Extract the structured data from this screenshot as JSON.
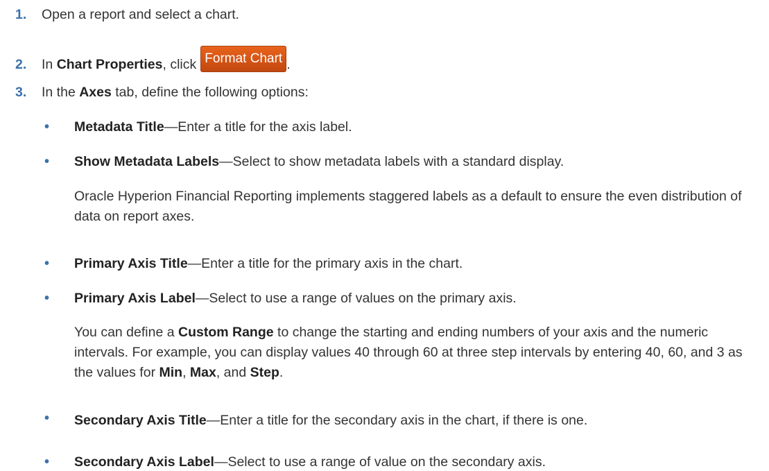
{
  "steps": [
    {
      "num": "1.",
      "text": "Open a report and select a chart."
    },
    {
      "num": "2.",
      "pre": "In ",
      "bold": "Chart Properties",
      "post": ", click",
      "button_label": "Format Chart",
      "after": "."
    },
    {
      "num": "3.",
      "pre": "In the ",
      "bold": "Axes",
      "post": " tab, define the following options:"
    }
  ],
  "options": [
    {
      "bullet": "•",
      "term": "Metadata Title",
      "desc": "—Enter a title for the axis label."
    },
    {
      "bullet": "•",
      "term": "Show Metadata Labels",
      "desc": "—Select to show metadata labels with a standard display."
    },
    {
      "bullet": "•",
      "term": "Primary Axis Title",
      "desc": "—Enter a title for the primary axis in the chart."
    },
    {
      "bullet": "•",
      "term": "Primary Axis Label",
      "desc": "—Select to use a range of values on the primary axis."
    },
    {
      "bullet": "•",
      "term": "Secondary Axis Title",
      "desc": "—Enter a title for the secondary axis in the chart, if there is one."
    },
    {
      "bullet": "•",
      "term": "Secondary Axis Label",
      "desc": "—Select to use a range of value on the secondary axis."
    }
  ],
  "notes": {
    "staggered": "Oracle Hyperion Financial Reporting implements staggered labels as a default to ensure the even distribution of data on report axes.",
    "range_pre": "You can define a ",
    "range_bold": "Custom Range",
    "range_mid": " to change the starting and ending numbers of your axis and the numeric intervals. For example, you can display values 40 through 60 at three step intervals by entering 40, 60, and 3 as the values for ",
    "min": "Min",
    "sep1": ", ",
    "max": "Max",
    "sep2": ", and ",
    "step": "Step",
    "end": "."
  },
  "colors": {
    "accent": "#3a72ab",
    "button": "#d4541a",
    "text": "#333333"
  }
}
